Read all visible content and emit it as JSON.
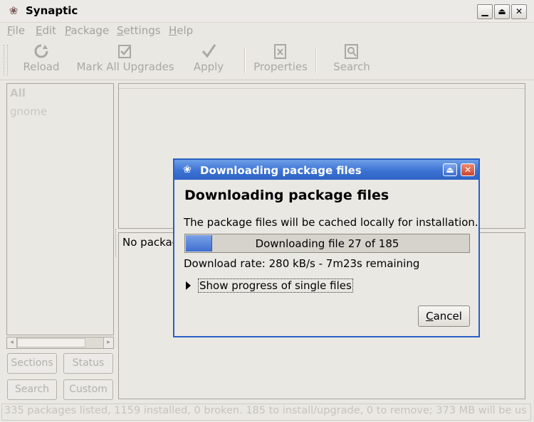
{
  "window": {
    "title": "Synaptic",
    "min_glyph": "▁",
    "max_glyph": "⏏",
    "close_glyph": "✕",
    "app_glyph": "❀"
  },
  "menubar": [
    {
      "key": "F",
      "rest": "ile"
    },
    {
      "key": "E",
      "rest": "dit"
    },
    {
      "key": "P",
      "rest": "ackage"
    },
    {
      "key": "S",
      "rest": "ettings"
    },
    {
      "key": "H",
      "rest": "elp"
    }
  ],
  "toolbar": {
    "reload": "Reload",
    "mark_all": "Mark All Upgrades",
    "apply": "Apply",
    "properties": "Properties",
    "search": "Search"
  },
  "sidebar": {
    "items": [
      "All",
      "gnome"
    ],
    "buttons": {
      "sections": "Sections",
      "status": "Status",
      "search": "Search",
      "custom": "Custom"
    }
  },
  "desc_pane": {
    "text": "No packag"
  },
  "statusbar": "335 packages listed, 1159 installed, 0 broken. 185 to install/upgrade, 0 to remove; 373 MB will be us",
  "dialog": {
    "title": "Downloading package files",
    "heading": "Downloading package files",
    "description": "The package files will be cached locally for installation.",
    "progress_text": "Downloading file 27 of 185",
    "progress_fraction": 0.09,
    "rate_text": "Download rate: 280 kB/s - 7m23s remaining",
    "expander_label": "Show progress of single files",
    "cancel_label": {
      "key": "C",
      "rest": "ancel"
    },
    "title_icon_glyph": "❀",
    "rollup_glyph": "⏏",
    "close_glyph": "✕"
  },
  "colors": {
    "accent": "#3c73d3",
    "progress_fill": "#4f7edb",
    "close_red": "#d9543f"
  }
}
